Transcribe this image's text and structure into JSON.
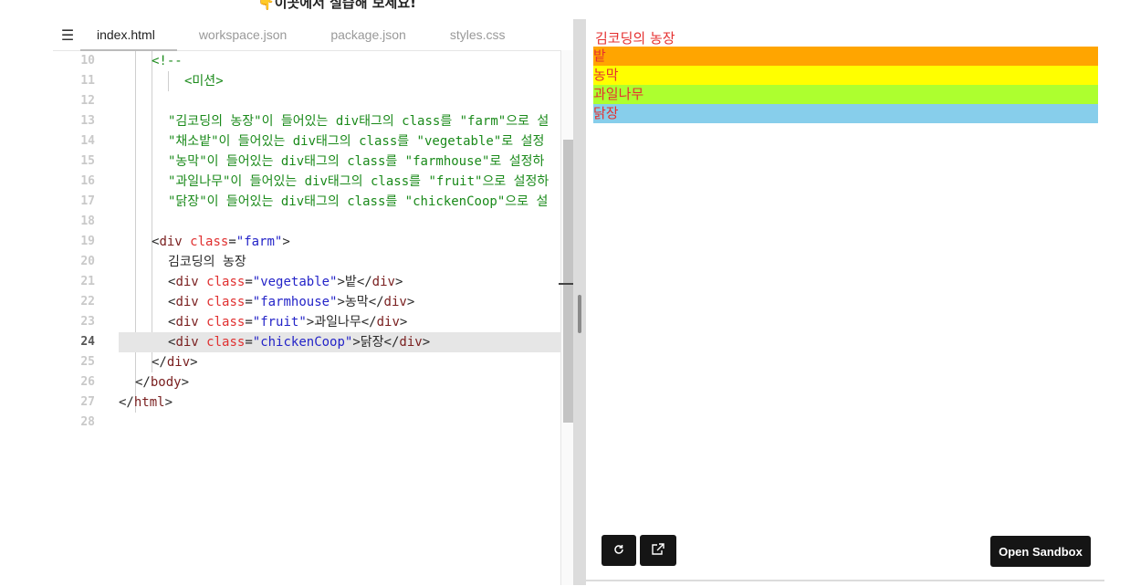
{
  "banner": {
    "text": "이곳에서 실습해 보세요!",
    "marker": "👇"
  },
  "tabs": [
    {
      "label": "index.html"
    },
    {
      "label": "workspace.json"
    },
    {
      "label": "package.json"
    },
    {
      "label": "styles.css"
    }
  ],
  "editor": {
    "active_line": "24",
    "lines": [
      {
        "n": "10"
      },
      {
        "n": "11"
      },
      {
        "n": "12"
      },
      {
        "n": "13"
      },
      {
        "n": "14"
      },
      {
        "n": "15"
      },
      {
        "n": "16"
      },
      {
        "n": "17"
      },
      {
        "n": "18"
      },
      {
        "n": "19"
      },
      {
        "n": "20"
      },
      {
        "n": "21"
      },
      {
        "n": "22"
      },
      {
        "n": "23"
      },
      {
        "n": "24"
      },
      {
        "n": "25"
      },
      {
        "n": "26"
      },
      {
        "n": "27"
      },
      {
        "n": "28"
      }
    ],
    "code": {
      "l10": "<!--",
      "l11": "<미션>",
      "l13": "\"김코딩의 농장\"이 들어있는 div태그의 class를 \"farm\"으로 설",
      "l14": "\"채소밭\"이 들어있는 div태그의 class를 \"vegetable\"로 설정",
      "l15": "\"농막\"이 들어있는 div태그의 class를 \"farmhouse\"로 설정하",
      "l16": "\"과일나무\"이 들어있는 div태그의 class를 \"fruit\"으로 설정하",
      "l17": "\"닭장\"이 들어있는 div태그의 class를 \"chickenCoop\"으로 설",
      "tag_div": "div",
      "tag_body": "body",
      "tag_html": "html",
      "attr_class": "class",
      "v_farm": "\"farm\"",
      "v_vegetable": "\"vegetable\"",
      "v_farmhouse": "\"farmhouse\"",
      "v_fruit": "\"fruit\"",
      "v_chicken": "\"chickenCoop\"",
      "t_farm": "김코딩의 농장",
      "t_vegetable": "밭",
      "t_farmhouse": "농막",
      "t_fruit": "과일나무",
      "t_chicken": "닭장"
    }
  },
  "preview": {
    "title": "김코딩의 농장",
    "items": [
      {
        "label": "밭",
        "color": "#ffa500"
      },
      {
        "label": "농막",
        "color": "#ffff00"
      },
      {
        "label": "과일나무",
        "color": "#adff2f"
      },
      {
        "label": "닭장",
        "color": "#87ceeb"
      }
    ],
    "open_sandbox_label": "Open Sandbox",
    "refresh_icon": "↻",
    "external_icon": "↗"
  },
  "colors": {
    "text_red": "#e53030",
    "button_dark": "#151515",
    "comment_green": "#1a8a1a"
  }
}
